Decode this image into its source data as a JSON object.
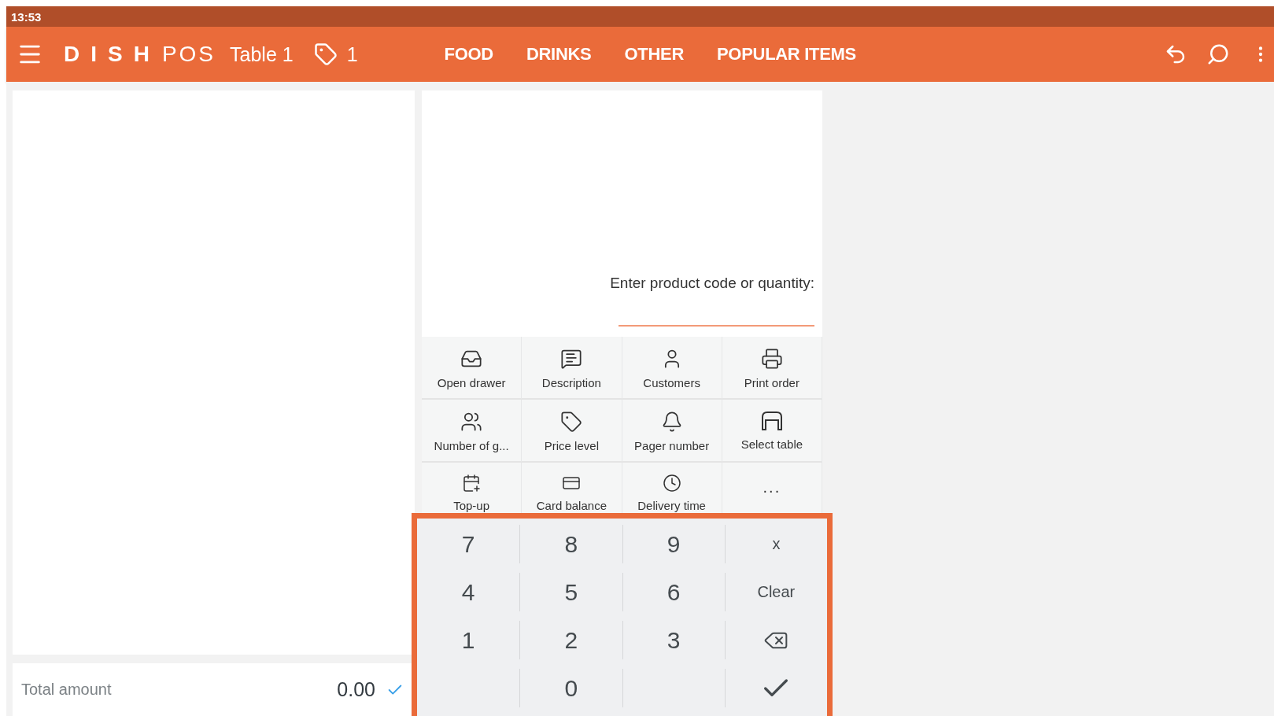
{
  "status_bar": {
    "time": "13:53"
  },
  "header": {
    "brand_bold": "DISH",
    "brand_light": "POS",
    "table": "Table 1",
    "tag_count": "1",
    "tabs": [
      {
        "label": "FOOD"
      },
      {
        "label": "DRINKS"
      },
      {
        "label": "OTHER"
      },
      {
        "label": "POPULAR ITEMS"
      }
    ]
  },
  "order": {
    "total_label": "Total amount",
    "total_value": "0.00",
    "confirmed": true
  },
  "entry": {
    "prompt": "Enter product code or quantity:"
  },
  "actions": [
    {
      "label": "Open drawer"
    },
    {
      "label": "Description"
    },
    {
      "label": "Customers"
    },
    {
      "label": "Print order"
    },
    {
      "label": "Number of g..."
    },
    {
      "label": "Price level"
    },
    {
      "label": "Pager number"
    },
    {
      "label": "Select table"
    },
    {
      "label": "Top-up"
    },
    {
      "label": "Card balance"
    },
    {
      "label": "Delivery time"
    },
    {
      "label": "...",
      "kind": "more"
    }
  ],
  "numpad": [
    {
      "kind": "digit",
      "label": "7"
    },
    {
      "kind": "digit",
      "label": "8"
    },
    {
      "kind": "digit",
      "label": "9"
    },
    {
      "kind": "text",
      "label": "x"
    },
    {
      "kind": "digit",
      "label": "4"
    },
    {
      "kind": "digit",
      "label": "5"
    },
    {
      "kind": "digit",
      "label": "6"
    },
    {
      "kind": "text",
      "label": "Clear"
    },
    {
      "kind": "digit",
      "label": "1"
    },
    {
      "kind": "digit",
      "label": "2"
    },
    {
      "kind": "digit",
      "label": "3"
    },
    {
      "kind": "backspace"
    },
    {
      "kind": "blank"
    },
    {
      "kind": "digit",
      "label": "0"
    },
    {
      "kind": "blank"
    },
    {
      "kind": "confirm"
    }
  ]
}
